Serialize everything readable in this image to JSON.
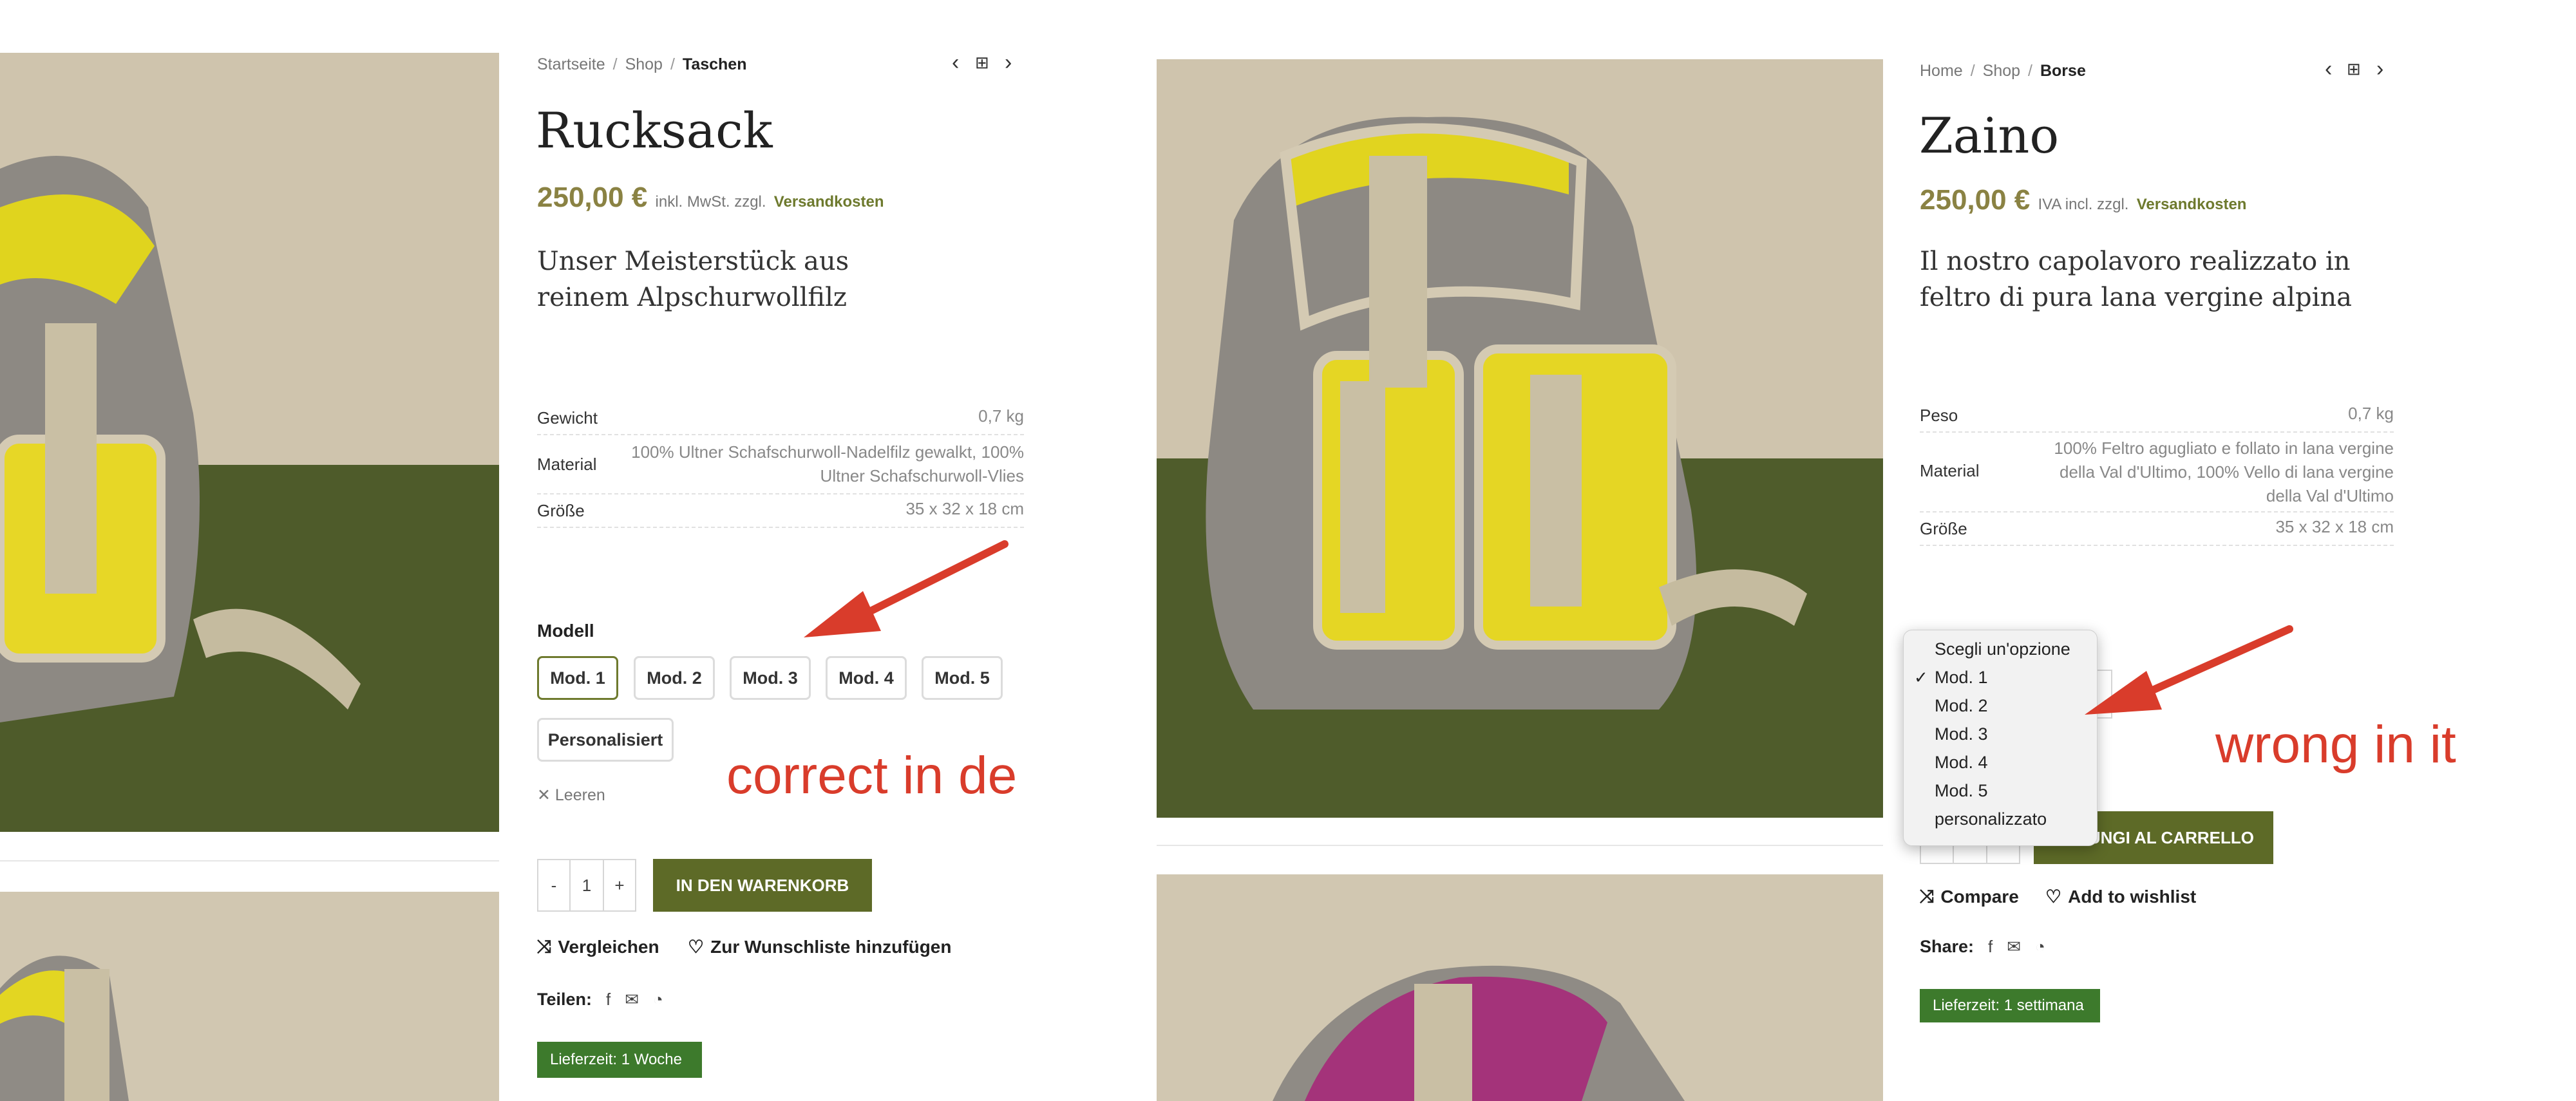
{
  "colors": {
    "accent_olive": "#6e7a2e",
    "price": "#8a8243",
    "cart_button": "#5d6a27",
    "badge": "#3d7a2c",
    "annotation_red": "#d93c2b"
  },
  "left": {
    "breadcrumb": {
      "home": "Startseite",
      "shop": "Shop",
      "current": "Taschen"
    },
    "title": "Rucksack",
    "price": {
      "amount": "250,00 €",
      "tax_note": "inkl. MwSt. zzgl.",
      "shipping_link": "Versandkosten"
    },
    "description": "Unser Meisterstück aus reinem Alpschurwollfilz",
    "attributes": [
      {
        "key": "Gewicht",
        "value": "0,7 kg"
      },
      {
        "key": "Material",
        "value": "100% Ultner Schafschurwoll-Nadelfilz gewalkt, 100% Ultner Schafschurwoll-Vlies"
      },
      {
        "key": "Größe",
        "value": "35 x 32 x 18 cm"
      }
    ],
    "variation_label": "Modell",
    "swatches": [
      "Mod. 1",
      "Mod. 2",
      "Mod. 3",
      "Mod. 4",
      "Mod. 5",
      "Personalisiert"
    ],
    "selected_swatch": "Mod. 1",
    "clear_label": "Leeren",
    "quantity": {
      "minus": "-",
      "value": "1",
      "plus": "+"
    },
    "add_to_cart": "IN DEN WARENKORB",
    "compare": "Vergleichen",
    "wishlist": "Zur Wunschliste hinzufügen",
    "share_label": "Teilen:",
    "delivery": "Lieferzeit: 1 Woche"
  },
  "right": {
    "breadcrumb": {
      "home": "Home",
      "shop": "Shop",
      "current": "Borse"
    },
    "title": "Zaino",
    "price": {
      "amount": "250,00 €",
      "tax_note": "IVA incl. zzgl.",
      "shipping_link": "Versandkosten"
    },
    "description": "Il nostro capolavoro realizzato in feltro di pura lana vergine alpina",
    "attributes": [
      {
        "key": "Peso",
        "value": "0,7 kg"
      },
      {
        "key": "Material",
        "value": "100% Feltro agugliato e follato in lana vergine della Val d'Ultimo, 100% Vello di lana vergine della Val d'Ultimo"
      },
      {
        "key": "Größe",
        "value": "35 x 32 x 18 cm"
      }
    ],
    "dropdown": {
      "options": [
        "Scegli un'opzione",
        "Mod. 1",
        "Mod. 2",
        "Mod. 3",
        "Mod. 4",
        "Mod. 5",
        "personalizzato"
      ],
      "selected": "Mod. 1",
      "checkmark": "✓"
    },
    "add_to_cart_partial": "IUNGI AL CARRELLO",
    "compare": "Compare",
    "wishlist": "Add to wishlist",
    "share_label": "Share:",
    "delivery": "Lieferzeit: 1 settimana"
  },
  "icons": {
    "prev": "chevron-left-icon",
    "grid": "grid-icon",
    "next": "chevron-right-icon",
    "compare": "shuffle-icon",
    "wishlist": "heart-icon",
    "facebook": "facebook-icon",
    "email": "mail-icon",
    "whatsapp": "whatsapp-icon",
    "clear": "close-icon"
  },
  "annotations": {
    "left_note": "correct in de",
    "right_note": "wrong in it"
  }
}
